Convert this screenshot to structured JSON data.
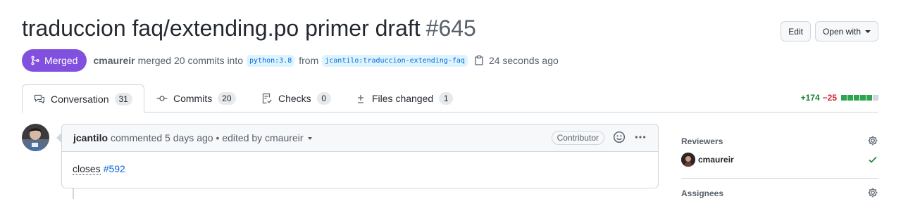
{
  "header": {
    "title": "traduccion faq/extending.po primer draft",
    "number": "#645",
    "edit_label": "Edit",
    "open_with_label": "Open with"
  },
  "status": {
    "state_label": "Merged",
    "author": "cmaureir",
    "merged_text": "merged 20 commits into",
    "base_branch": "python:3.8",
    "from_text": "from",
    "head_branch": "jcantilo:traduccion-extending-faq",
    "time_ago": "24 seconds ago"
  },
  "tabs": [
    {
      "label": "Conversation",
      "count": "31",
      "icon": "comment-discussion-icon"
    },
    {
      "label": "Commits",
      "count": "20",
      "icon": "git-commit-icon"
    },
    {
      "label": "Checks",
      "count": "0",
      "icon": "checklist-icon"
    },
    {
      "label": "Files changed",
      "count": "1",
      "icon": "file-diff-icon"
    }
  ],
  "diffstat": {
    "additions": "+174",
    "deletions": "−25",
    "blocks": [
      "added",
      "added",
      "added",
      "added",
      "added",
      "neutral"
    ]
  },
  "comment": {
    "author": "jcantilo",
    "meta": "commented 5 days ago",
    "edited_text": "• edited by cmaureir",
    "badge": "Contributor",
    "body_text": "closes",
    "issue_link": "#592"
  },
  "sidebar": {
    "reviewers_title": "Reviewers",
    "reviewer_name": "cmaureir",
    "assignees_title": "Assignees"
  },
  "colors": {
    "merged": "#8250df",
    "added": "#2da44e",
    "deleted": "#cf222e",
    "link": "#0969da"
  }
}
